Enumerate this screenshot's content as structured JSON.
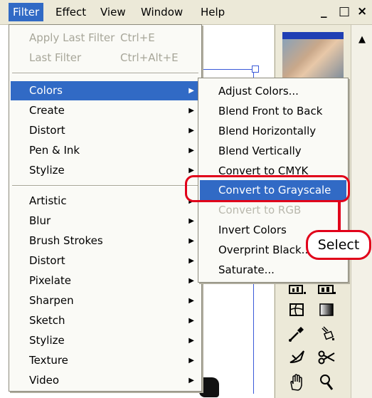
{
  "menubar": {
    "items": [
      "Filter",
      "Effect",
      "View",
      "Window",
      "Help"
    ],
    "window_buttons": [
      "_",
      "□",
      "×"
    ]
  },
  "filter_menu": {
    "top_items": [
      {
        "label": "Apply Last Filter",
        "shortcut": "Ctrl+E",
        "enabled": false
      },
      {
        "label": "Last Filter",
        "shortcut": "Ctrl+Alt+E",
        "enabled": false
      }
    ],
    "group1": [
      "Colors",
      "Create",
      "Distort",
      "Pen & Ink",
      "Stylize"
    ],
    "group2": [
      "Artistic",
      "Blur",
      "Brush Strokes",
      "Distort",
      "Pixelate",
      "Sharpen",
      "Sketch",
      "Stylize",
      "Texture",
      "Video"
    ],
    "highlighted": "Colors"
  },
  "colors_submenu": {
    "items": [
      {
        "label": "Adjust Colors...",
        "enabled": true
      },
      {
        "label": "Blend Front to Back",
        "enabled": true
      },
      {
        "label": "Blend Horizontally",
        "enabled": true
      },
      {
        "label": "Blend Vertically",
        "enabled": true
      },
      {
        "label": "Convert to CMYK",
        "enabled": true
      },
      {
        "label": "Convert to Grayscale",
        "enabled": true
      },
      {
        "label": "Convert to RGB",
        "enabled": false
      },
      {
        "label": "Invert Colors",
        "enabled": true
      },
      {
        "label": "Overprint Black...",
        "enabled": true
      },
      {
        "label": "Saturate...",
        "enabled": true
      }
    ],
    "highlighted": "Convert to Grayscale"
  },
  "callout": {
    "label": "Select",
    "color": "#e1001a"
  },
  "colors": {
    "highlight": "#316ac5",
    "menubar_bg": "#ece9d8"
  },
  "toolpanel": {
    "tools": [
      "graph-tool",
      "graph-column-tool",
      "mesh-tool",
      "gradient-tool",
      "eyedropper-tool",
      "paint-bucket-tool",
      "knife-tool",
      "scissors-tool",
      "hand-tool",
      "zoom-tool"
    ]
  }
}
